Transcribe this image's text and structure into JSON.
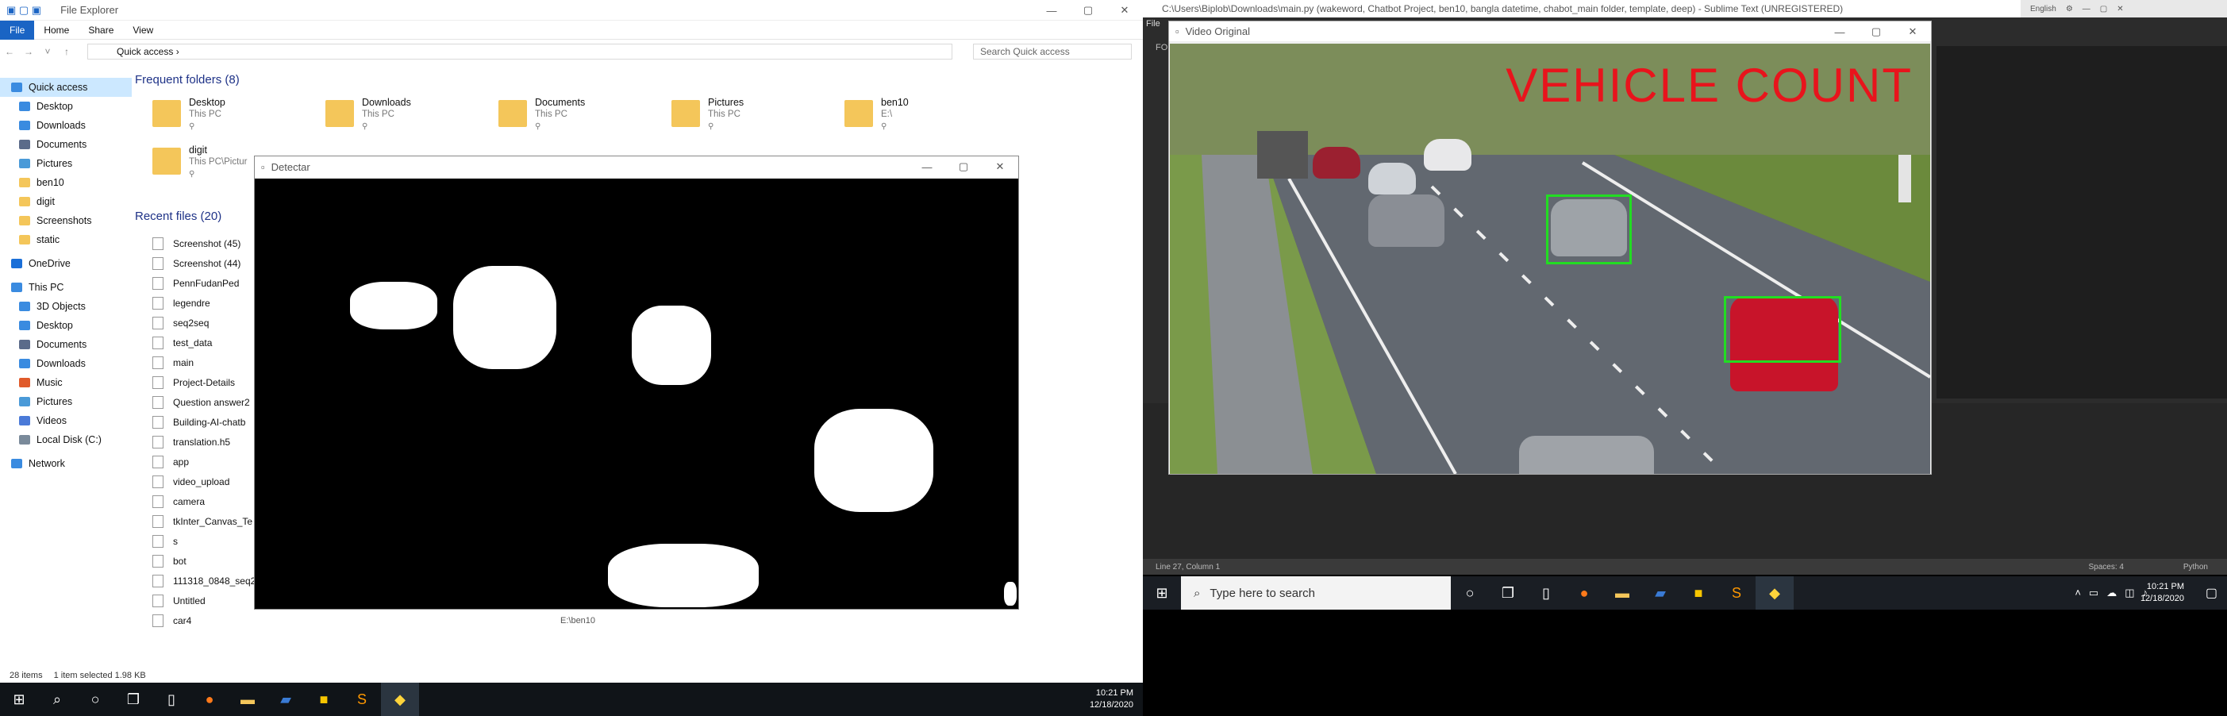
{
  "explorer": {
    "title": "File Explorer",
    "tabs": [
      "File",
      "Home",
      "Share",
      "View"
    ],
    "address": "Quick access",
    "search_placeholder": "Search Quick access",
    "nav": [
      {
        "label": "Quick access",
        "kind": "star"
      },
      {
        "label": "Desktop",
        "kind": "blue"
      },
      {
        "label": "Downloads",
        "kind": "down"
      },
      {
        "label": "Documents",
        "kind": "doc"
      },
      {
        "label": "Pictures",
        "kind": "pic"
      },
      {
        "label": "ben10",
        "kind": "folder"
      },
      {
        "label": "digit",
        "kind": "folder"
      },
      {
        "label": "Screenshots",
        "kind": "folder"
      },
      {
        "label": "static",
        "kind": "folder"
      },
      {
        "label": "OneDrive",
        "kind": "cloud"
      },
      {
        "label": "This PC",
        "kind": "pc"
      },
      {
        "label": "3D Objects",
        "kind": "blue"
      },
      {
        "label": "Desktop",
        "kind": "blue"
      },
      {
        "label": "Documents",
        "kind": "doc"
      },
      {
        "label": "Downloads",
        "kind": "down"
      },
      {
        "label": "Music",
        "kind": "music"
      },
      {
        "label": "Pictures",
        "kind": "pic"
      },
      {
        "label": "Videos",
        "kind": "vid"
      },
      {
        "label": "Local Disk (C:)",
        "kind": "disk"
      },
      {
        "label": "Network",
        "kind": "net"
      }
    ],
    "frequent_header": "Frequent folders (8)",
    "frequent": [
      {
        "name": "Desktop",
        "path": "This PC"
      },
      {
        "name": "Downloads",
        "path": "This PC"
      },
      {
        "name": "Documents",
        "path": "This PC"
      },
      {
        "name": "Pictures",
        "path": "This PC"
      },
      {
        "name": "ben10",
        "path": "E:\\"
      },
      {
        "name": "digit",
        "path": "This PC\\Pictur"
      }
    ],
    "recent_header": "Recent files (20)",
    "recent": [
      "Screenshot (45)",
      "Screenshot (44)",
      "PennFudanPed",
      "legendre",
      "seq2seq",
      "test_data",
      "main",
      "Project-Details",
      "Question answer2",
      "Building-AI-chatb",
      "translation.h5",
      "app",
      "video_upload",
      "camera",
      "tkInter_Canvas_Te",
      "s",
      "bot",
      "111318_0848_seq2",
      "Untitled",
      "car4"
    ],
    "status_items": "28 items",
    "status_selected": "1 item selected  1.98 KB",
    "ben10_path": "E:\\ben10"
  },
  "detectar": {
    "title": "Detectar"
  },
  "sublime": {
    "title": "C:\\Users\\Biplob\\Downloads\\main.py (wakeword, Chatbot Project, ben10, bangla datetime, chabot_main folder, template, deep) - Sublime Text (UNREGISTERED)",
    "status_left": "Line 27, Column 1",
    "status_spaces": "Spaces: 4",
    "status_lang": "Python",
    "lang_indicator": "English",
    "menu_file": "File",
    "folders_label": "FO"
  },
  "video": {
    "title": "Video Original",
    "overlay": "VEHICLE  COUNT"
  },
  "taskbar_right": {
    "search": "Type here to search",
    "time": "10:21 PM",
    "date": "12/18/2020"
  },
  "taskbar_left": {
    "time": "10:21 PM",
    "date": "12/18/2020"
  }
}
